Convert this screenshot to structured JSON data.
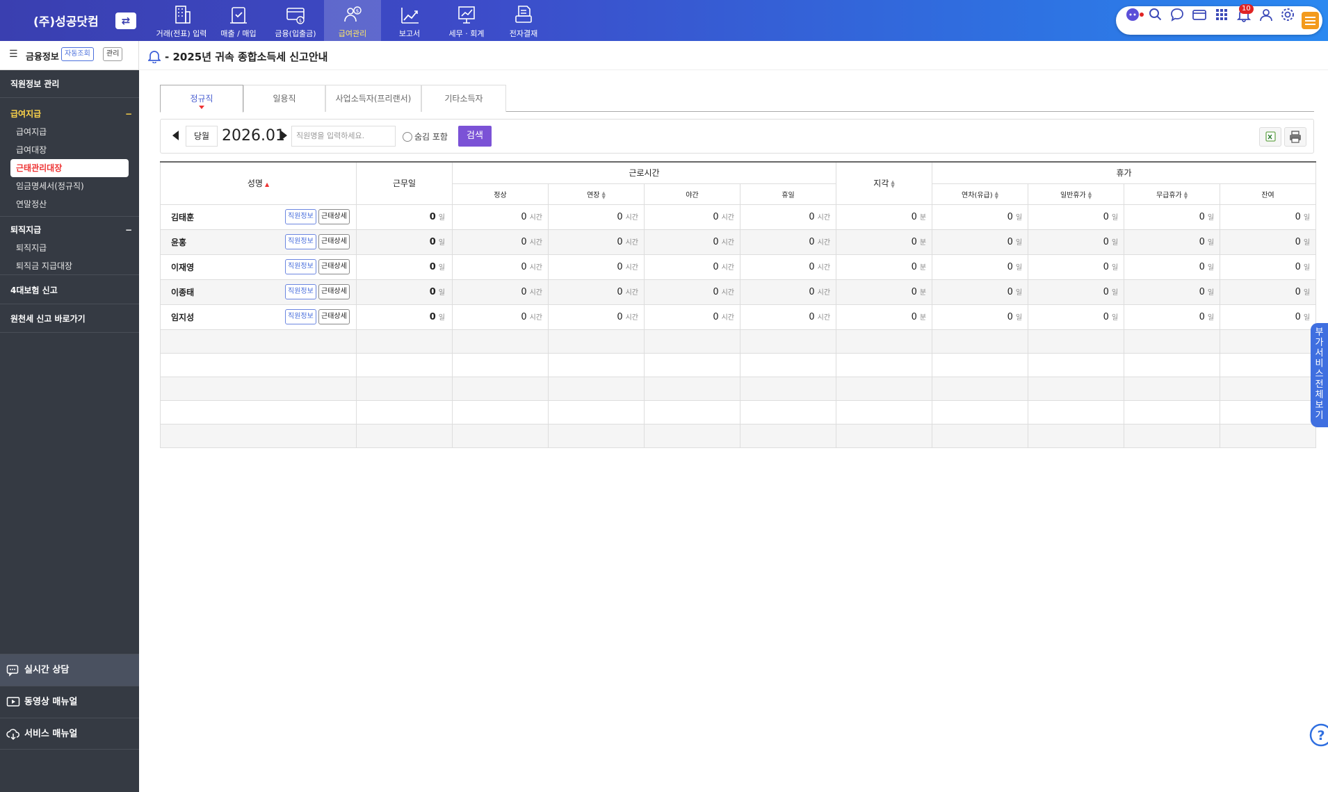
{
  "company": {
    "name": "(주)성공닷컴",
    "switch_icon": "swap-icon"
  },
  "nav": [
    {
      "label": "거래(전표) 입력",
      "icon": "building-icon",
      "active": false
    },
    {
      "label": "매출 / 매입",
      "icon": "clipboard-check-icon",
      "active": false
    },
    {
      "label": "금융(입출금)",
      "icon": "bank-card-icon",
      "active": false
    },
    {
      "label": "급여관리",
      "icon": "payroll-person-icon",
      "active": true
    },
    {
      "label": "보고서",
      "icon": "chart-rise-icon",
      "active": false
    },
    {
      "label": "세무 · 회계",
      "icon": "presentation-chart-icon",
      "active": false
    },
    {
      "label": "전자결재",
      "icon": "printer-doc-icon",
      "active": false
    }
  ],
  "toolbar": {
    "notification_count": "10",
    "accent": "#f39a1c"
  },
  "sidebar": {
    "finance_title": "금융정보",
    "finance_auto": "자동조회",
    "finance_manage": "관리",
    "staff_manage": "직원정보 관리",
    "salary_section": {
      "title": "급여지급",
      "toggle": "−",
      "items": [
        "급여지급",
        "급여대장",
        "근태관리대장",
        "임금명세서(정규직)",
        "연말정산"
      ],
      "selected": 2
    },
    "retire_section": {
      "title": "퇴직지급",
      "toggle": "−",
      "items": [
        "퇴직지급",
        "퇴직금 지급대장"
      ]
    },
    "insurance": "4대보험 신고",
    "withholding": "원천세 신고 바로가기",
    "bottom": [
      "실시간 상담",
      "동영상 매뉴얼",
      "서비스 매뉴얼"
    ]
  },
  "notice": {
    "title": "- 2025년 귀속 종합소득세 신고안내"
  },
  "tabs": [
    "정규직",
    "일용직",
    "사업소득자(프리랜서)",
    "기타소득자"
  ],
  "filter": {
    "current_month": "당월",
    "period": "2026.01",
    "search_placeholder": "직원명을 입력하세요.",
    "hidden_include": "숨김 포함",
    "search_button": "검색"
  },
  "table": {
    "headers": {
      "name": "성명",
      "workdays": "근무일",
      "work_hours": "근로시간",
      "late": "지각",
      "leave": "휴가",
      "sub_hours": [
        "정상",
        "연장",
        "야간",
        "휴일"
      ],
      "sub_leave": [
        "연차(유급)",
        "일반휴가",
        "무급휴가",
        "잔여"
      ]
    },
    "btn_info": "직원정보",
    "btn_detail": "근태상세",
    "units": {
      "day": "일",
      "hour": "시간",
      "minute": "분"
    },
    "rows": [
      {
        "name": "김태훈",
        "workdays": "0",
        "normal": "0",
        "overtime": "0",
        "night": "0",
        "holiday": "0",
        "late": "0",
        "annual": "0",
        "general": "0",
        "unpaid": "0",
        "remain": "0"
      },
      {
        "name": "윤홍",
        "workdays": "0",
        "normal": "0",
        "overtime": "0",
        "night": "0",
        "holiday": "0",
        "late": "0",
        "annual": "0",
        "general": "0",
        "unpaid": "0",
        "remain": "0"
      },
      {
        "name": "이재영",
        "workdays": "0",
        "normal": "0",
        "overtime": "0",
        "night": "0",
        "holiday": "0",
        "late": "0",
        "annual": "0",
        "general": "0",
        "unpaid": "0",
        "remain": "0"
      },
      {
        "name": "이종태",
        "workdays": "0",
        "normal": "0",
        "overtime": "0",
        "night": "0",
        "holiday": "0",
        "late": "0",
        "annual": "0",
        "general": "0",
        "unpaid": "0",
        "remain": "0"
      },
      {
        "name": "임지성",
        "workdays": "0",
        "normal": "0",
        "overtime": "0",
        "night": "0",
        "holiday": "0",
        "late": "0",
        "annual": "0",
        "general": "0",
        "unpaid": "0",
        "remain": "0"
      }
    ],
    "empty_rows": 5
  },
  "side_tab": "부가서비스 전체보기"
}
